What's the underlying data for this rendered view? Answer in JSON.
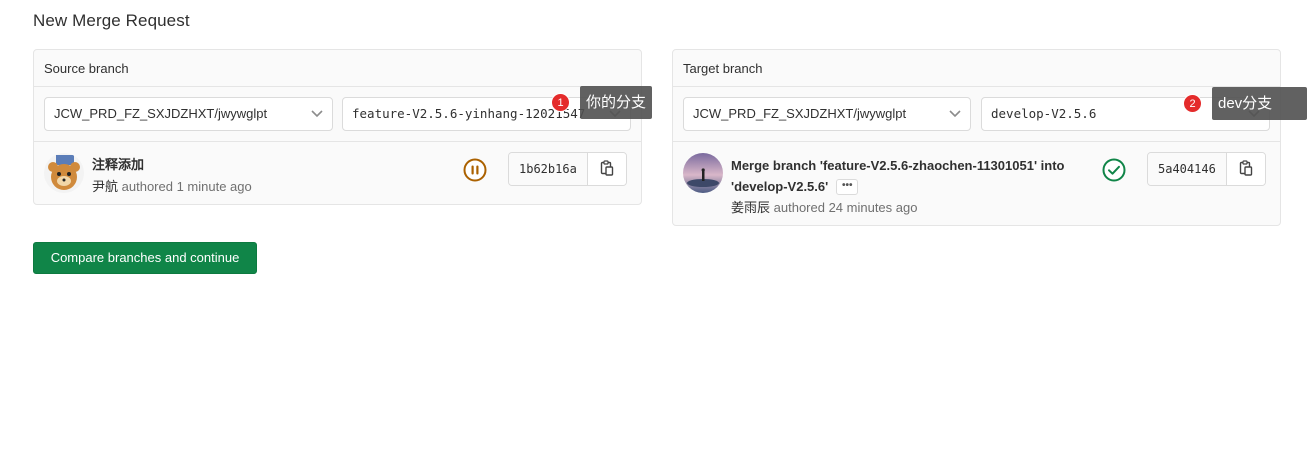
{
  "page": {
    "title": "New Merge Request"
  },
  "source": {
    "header": "Source branch",
    "project": "JCW_PRD_FZ_SXJDZHXT/jwywglpt",
    "branch": "feature-V2.5.6-yinhang-12021547",
    "commit": {
      "title": "注释添加",
      "author": "尹航",
      "meta": "authored 1 minute ago",
      "status": "paused",
      "sha": "1b62b16a"
    }
  },
  "target": {
    "header": "Target branch",
    "project": "JCW_PRD_FZ_SXJDZHXT/jwywglpt",
    "branch": "develop-V2.5.6",
    "commit": {
      "title_line1": "Merge branch 'feature-V2.5.6-zhaochen-11301051' into",
      "title_line2": "'develop-V2.5.6'",
      "author": "姜雨辰",
      "meta": "authored 24 minutes ago",
      "status": "success",
      "sha": "5a404146"
    }
  },
  "actions": {
    "compare_label": "Compare branches and continue"
  },
  "annotations": [
    {
      "number": "1",
      "text": "你的分支"
    },
    {
      "number": "2",
      "text": "dev分支"
    }
  ],
  "colors": {
    "primary": "#108548",
    "paused": "#ab6100",
    "success": "#108548",
    "badge": "#e42b2b"
  }
}
